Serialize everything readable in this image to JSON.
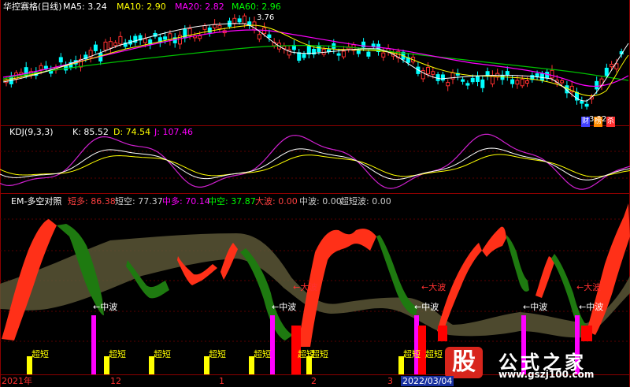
{
  "price_panel": {
    "title": "华控赛格(日线)",
    "ma": [
      {
        "label": "MA5: 3.24",
        "color": "#ffffff"
      },
      {
        "label": "MA10: 2.90",
        "color": "#ffff00"
      },
      {
        "label": "MA20: 2.82",
        "color": "#ff00ff"
      },
      {
        "label": "MA60: 2.96",
        "color": "#00ff00"
      }
    ],
    "high_marker": "3.76",
    "low_marker": "3.32",
    "badges": [
      "财",
      "榜",
      "杀"
    ]
  },
  "kdj_panel": {
    "title": "KDJ(9,3,3)",
    "k": "K: 85.52",
    "d": "D: 74.54",
    "j": "J: 107.46"
  },
  "em_panel": {
    "title": "EM-多空对照",
    "items": [
      {
        "label": "短多: 86.38",
        "color": "#ff4040"
      },
      {
        "label": "短空: 77.37",
        "color": "#cccccc"
      },
      {
        "label": "中多: 70.14",
        "color": "#ff00ff"
      },
      {
        "label": "中空: 37.87",
        "color": "#00ff00"
      },
      {
        "label": "大波: 0.00",
        "color": "#ff4040"
      },
      {
        "label": "中波: 0.00",
        "color": "#cccccc"
      },
      {
        "label": "超短波: 0.00",
        "color": "#cccccc"
      }
    ],
    "mid_wave_label": "←中波",
    "big_wave_label": "←大波",
    "ultra_short_label": "超短"
  },
  "x_axis": {
    "labels": [
      "2021年",
      "12",
      "1",
      "2",
      "3",
      "2022/03/04"
    ]
  },
  "watermark": {
    "glyph": "股",
    "title": "公式之家",
    "url": "www.gszj100.com"
  },
  "colors": {
    "up": "#ff3030",
    "down": "#00ffff",
    "border": "#8b0000",
    "red_wave": "#ff3018",
    "green_wave": "#1e7a10",
    "olive": "#5a5636"
  }
}
